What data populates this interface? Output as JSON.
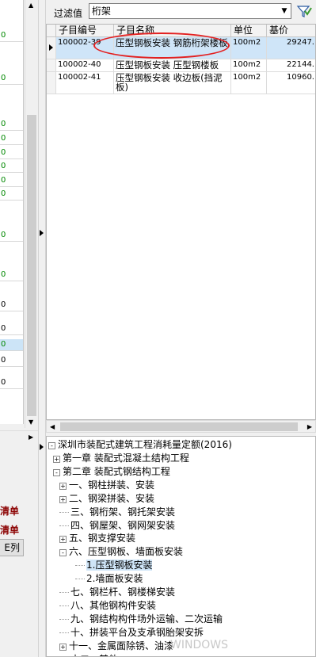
{
  "left_panel": {
    "rows": [
      {
        "text": "0",
        "green": true,
        "sel": false
      },
      {
        "text": "0",
        "green": true,
        "sel": false
      },
      {
        "text": "0",
        "green": true,
        "sel": false
      },
      {
        "text": "0",
        "green": true,
        "sel": false
      },
      {
        "text": "0",
        "green": true,
        "sel": false
      },
      {
        "text": "0",
        "green": true,
        "sel": false
      },
      {
        "text": "0",
        "green": true,
        "sel": false
      },
      {
        "text": "0",
        "green": true,
        "sel": false
      },
      {
        "text": "0",
        "green": true,
        "sel": false
      },
      {
        "text": "0",
        "green": true,
        "sel": false
      },
      {
        "text": "0",
        "green": false,
        "sel": false
      },
      {
        "text": "0",
        "green": false,
        "sel": false
      },
      {
        "text": "0",
        "green": true,
        "sel": true
      },
      {
        "text": "0",
        "green": false,
        "sel": false
      },
      {
        "text": "0",
        "green": false,
        "sel": false
      }
    ],
    "label_1": "清单",
    "label_2": "清单",
    "button": "E列"
  },
  "filter": {
    "label": "过滤值",
    "value": "桁架"
  },
  "grid": {
    "columns": [
      "子目编号",
      "子目名称",
      "单位",
      "基价"
    ],
    "rows": [
      {
        "code": "100002-39",
        "name": "压型钢板安装 钢筋桁架楼板",
        "unit": "100m2",
        "price": "29247."
      },
      {
        "code": "100002-40",
        "name": "压型钢板安装 压型钢楼板",
        "unit": "100m2",
        "price": "22144."
      },
      {
        "code": "100002-41",
        "name": "压型钢板安装 收边板(挡泥板)",
        "unit": "100m2",
        "price": "10960."
      }
    ]
  },
  "tree": {
    "root": "深圳市装配式建筑工程消耗量定额(2016)",
    "nodes": [
      {
        "label": "第一章 装配式混凝土结构工程",
        "exp": "+"
      },
      {
        "label": "第二章 装配式钢结构工程",
        "exp": "-"
      },
      {
        "label": "一、钢柱拼装、安装",
        "exp": "+"
      },
      {
        "label": "二、钢梁拼装、安装",
        "exp": "+"
      },
      {
        "label": "三、钢桁架、钢托架安装",
        "exp": ""
      },
      {
        "label": "四、钢屋架、钢网架安装",
        "exp": ""
      },
      {
        "label": "五、钢支撑安装",
        "exp": "+"
      },
      {
        "label": "六、压型钢板、墙面板安装",
        "exp": "-"
      },
      {
        "label": "1.压型钢板安装",
        "exp": "",
        "sel": true
      },
      {
        "label": "2.墙面板安装",
        "exp": ""
      },
      {
        "label": "七、钢栏杆、钢楼梯安装",
        "exp": ""
      },
      {
        "label": "八、其他钢构件安装",
        "exp": ""
      },
      {
        "label": "九、钢结构构件场外运输、二次运输",
        "exp": ""
      },
      {
        "label": "十、拼装平台及支承钢胎架安拆",
        "exp": ""
      },
      {
        "label": "十一、金属面除锈、油漆",
        "exp": "+"
      },
      {
        "label": "十二、其他",
        "exp": ""
      }
    ]
  },
  "watermark": "WINDOWS",
  "colors": {
    "selection": "#cfe5f8",
    "annotation": "#e32020",
    "label_red": "#8b0000"
  }
}
